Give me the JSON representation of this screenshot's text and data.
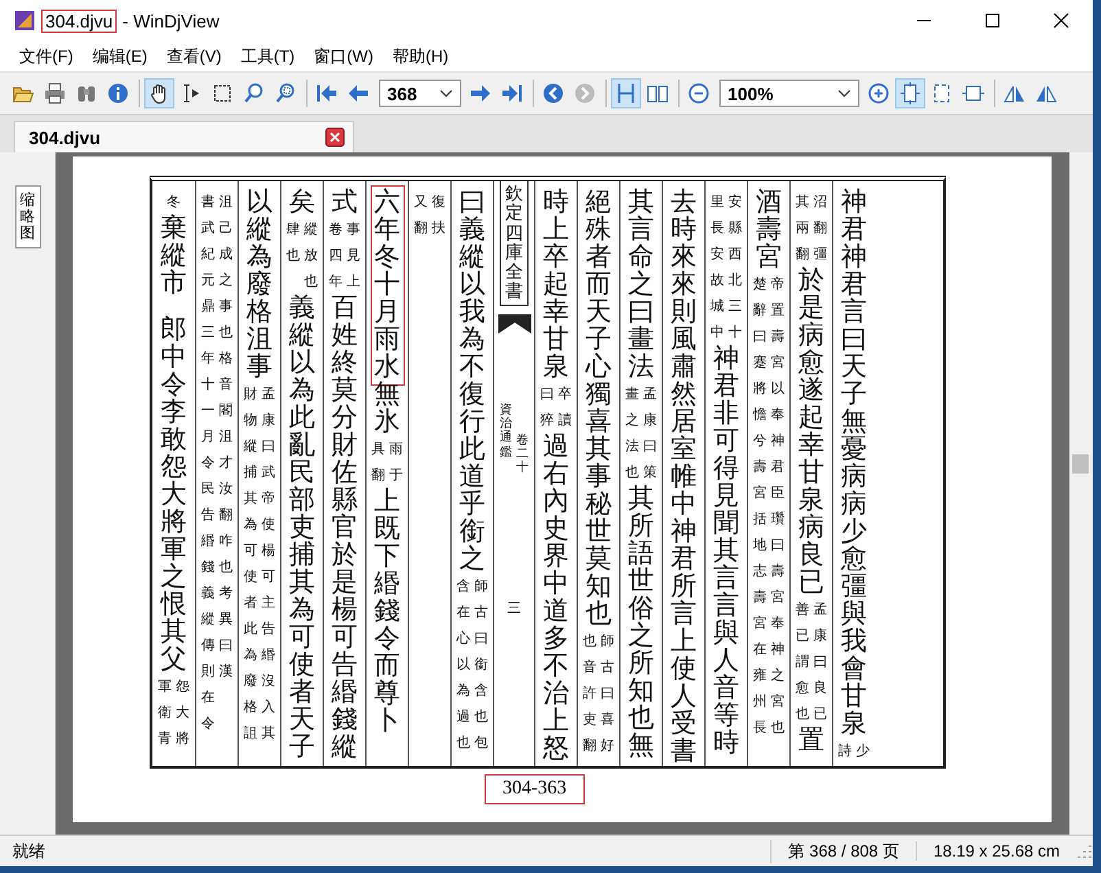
{
  "window": {
    "file_name": "304.djvu",
    "highlighted": true,
    "app_name": "- WinDjView"
  },
  "menu": [
    "文件(F)",
    "编辑(E)",
    "查看(V)",
    "工具(T)",
    "窗口(W)",
    "帮助(H)"
  ],
  "toolbar": {
    "buttons": [
      {
        "selected": false,
        "disabled": false
      },
      {
        "selected": false,
        "disabled": false
      },
      {
        "selected": false,
        "disabled": false
      },
      {
        "selected": false,
        "disabled": false
      },
      {
        "selected": true,
        "disabled": false
      },
      {
        "selected": false,
        "disabled": false
      },
      {
        "selected": false,
        "disabled": false
      },
      {
        "selected": false,
        "disabled": false
      },
      {
        "selected": false,
        "disabled": false
      },
      {
        "selected": false,
        "disabled": false
      },
      {
        "selected": false,
        "disabled": false
      },
      {
        "selected": false,
        "disabled": false
      },
      {
        "selected": false,
        "disabled": false
      },
      {
        "selected": false,
        "disabled": false
      },
      {
        "selected": false,
        "disabled": true
      },
      {
        "selected": true,
        "disabled": false
      },
      {
        "selected": false,
        "disabled": false
      },
      {
        "selected": false,
        "disabled": false
      },
      {
        "selected": false,
        "disabled": false
      },
      {
        "selected": true,
        "disabled": false
      },
      {
        "selected": false,
        "disabled": false
      },
      {
        "selected": false,
        "disabled": false
      },
      {
        "selected": false,
        "disabled": false
      },
      {
        "selected": false,
        "disabled": false
      }
    ],
    "page_box": {
      "value": "368"
    },
    "zoom_box": {
      "value": "100%"
    }
  },
  "tabs": [
    {
      "label": "304.djvu",
      "selected": true
    }
  ],
  "sidebar": {
    "tab": "缩略图"
  },
  "document": {
    "columns": [
      {
        "kind": "text",
        "segments": [
          {
            "kind": "note",
            "lines": [
              "冬"
            ]
          },
          {
            "kind": "main",
            "text": "棄縱市"
          },
          {
            "kind": "main",
            "text": "郎中令李敢怨大將軍之恨其父"
          },
          {
            "kind": "note",
            "lines": [
              "軍衛青",
              "怨大將"
            ]
          }
        ]
      },
      {
        "kind": "text",
        "segments": [
          {
            "kind": "note",
            "lines": [
              "書武紀元鼎三年十一月令民告緡錢義縱傳則在令",
              "沮己成之事也格音閣沮才汝翻咋也考異曰漢"
            ]
          }
        ]
      },
      {
        "kind": "text",
        "segments": [
          {
            "kind": "main",
            "text": "以縱為廢格沮事"
          },
          {
            "kind": "note",
            "lines": [
              "財物縱捕其為可使者此為廢格詛",
              "孟康曰武帝使楊可主告緡沒入其"
            ]
          }
        ]
      },
      {
        "kind": "text",
        "segments": [
          {
            "kind": "main",
            "text": "矣"
          },
          {
            "kind": "note",
            "lines": [
              "肆也",
              "縱放也"
            ]
          },
          {
            "kind": "main",
            "text": "義縱以為此亂民部吏捕其為可使者天子"
          }
        ]
      },
      {
        "kind": "text",
        "segments": [
          {
            "kind": "main",
            "text": "式"
          },
          {
            "kind": "note",
            "lines": [
              "卷四年",
              "事見上"
            ]
          },
          {
            "kind": "main",
            "text": "百姓終莫分財佐縣官於是楊可告緡錢縱"
          }
        ]
      },
      {
        "kind": "text",
        "segments": [
          {
            "kind": "main",
            "text": "六年冬十月雨水",
            "highlighted": true
          },
          {
            "kind": "main",
            "text": "無氷"
          },
          {
            "kind": "note",
            "lines": [
              "具翻",
              "雨于"
            ]
          },
          {
            "kind": "main",
            "text": "上既下緡錢令而尊卜"
          }
        ]
      },
      {
        "kind": "text",
        "segments": [
          {
            "kind": "note",
            "lines": [
              "又翻",
              "復扶"
            ]
          }
        ]
      },
      {
        "kind": "text",
        "segments": [
          {
            "kind": "main",
            "text": "曰義縱以我為不復行此道乎銜之"
          },
          {
            "kind": "note",
            "lines": [
              "含在心以為過也",
              "師古曰銜含也包"
            ]
          }
        ]
      },
      {
        "kind": "fold",
        "title": "欽定四庫全書",
        "book": "資治通鑑",
        "volume": "卷二十",
        "page": "三"
      },
      {
        "kind": "text",
        "segments": [
          {
            "kind": "main",
            "text": "時上卒起幸甘泉"
          },
          {
            "kind": "note",
            "lines": [
              "曰猝",
              "卒讀"
            ]
          },
          {
            "kind": "main",
            "text": "過右內史界中道多不治上怒"
          }
        ]
      },
      {
        "kind": "text",
        "segments": [
          {
            "kind": "main",
            "text": "絕殊者而天子心獨喜其事秘世莫知也"
          },
          {
            "kind": "note",
            "lines": [
              "也音許吏翻",
              "師古曰喜好"
            ]
          }
        ]
      },
      {
        "kind": "text",
        "segments": [
          {
            "kind": "main",
            "text": "其言命之曰畫法"
          },
          {
            "kind": "note",
            "lines": [
              "畫之法也",
              "孟康曰策"
            ]
          },
          {
            "kind": "main",
            "text": "其所語世俗之所知也無"
          }
        ]
      },
      {
        "kind": "text",
        "segments": [
          {
            "kind": "main",
            "text": "去時來來則風肅然居室帷中神君所言上使人受書"
          }
        ]
      },
      {
        "kind": "text",
        "segments": [
          {
            "kind": "note",
            "lines": [
              "里長安故城中",
              "安縣西北三十"
            ]
          },
          {
            "kind": "main",
            "text": "神君非可得見聞其言言與人音等時"
          }
        ]
      },
      {
        "kind": "text",
        "segments": [
          {
            "kind": "main",
            "text": "酒壽宮"
          },
          {
            "kind": "note",
            "lines": [
              "楚辭曰蹇將憺兮壽宮括地志壽宮在雍州長",
              "帝置壽宮以奉神君臣瓚曰壽宮奉神之宮也"
            ]
          }
        ]
      },
      {
        "kind": "text",
        "segments": [
          {
            "kind": "note",
            "lines": [
              "其兩翻",
              "沼翻彊"
            ]
          },
          {
            "kind": "main",
            "text": "於是病愈遂起幸甘泉病良已"
          },
          {
            "kind": "note",
            "lines": [
              "善已謂愈也",
              "孟康曰良已"
            ]
          },
          {
            "kind": "main",
            "text": "置"
          }
        ]
      },
      {
        "kind": "text",
        "segments": [
          {
            "kind": "main",
            "text": "神君神君言曰天子無憂病病少愈彊與我會甘泉"
          },
          {
            "kind": "note",
            "lines": [
              "詩",
              "少"
            ]
          }
        ]
      }
    ],
    "page_label": {
      "text": "304-363",
      "highlighted": true
    }
  },
  "status_bar": {
    "message": "就绪",
    "page": "第 368 / 808 页",
    "size": "18.19 x 25.68 cm"
  }
}
